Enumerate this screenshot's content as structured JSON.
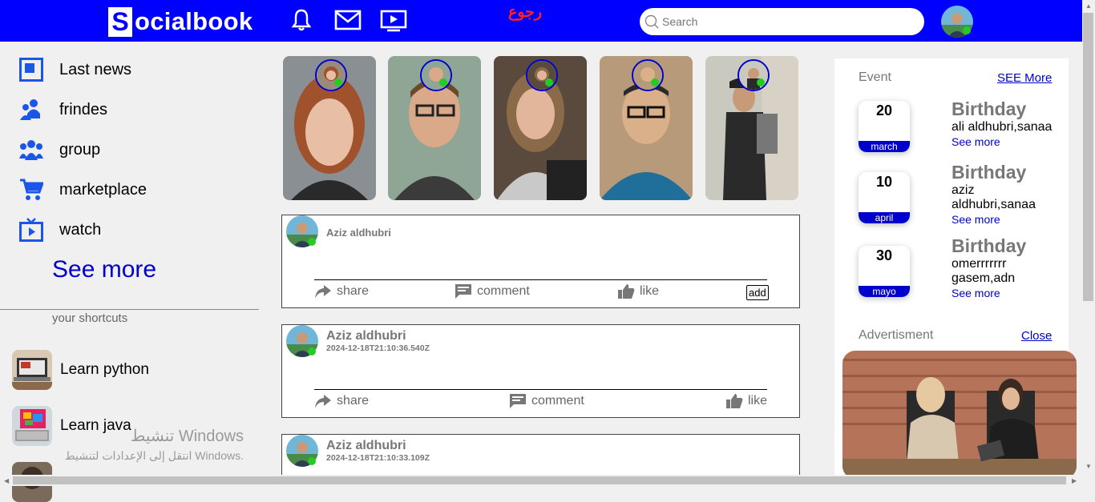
{
  "header": {
    "logo_letter": "S",
    "logo_text": "ocialbook",
    "back_link": "رجوع",
    "search_placeholder": "Search",
    "nav_icons": [
      "bell-icon",
      "mail-icon",
      "video-icon"
    ]
  },
  "sidebar": {
    "items": [
      {
        "label": "Last news",
        "icon": "news-icon"
      },
      {
        "label": "frindes",
        "icon": "friends-icon"
      },
      {
        "label": "group",
        "icon": "group-icon"
      },
      {
        "label": "marketplace",
        "icon": "cart-icon"
      },
      {
        "label": "watch",
        "icon": "tv-icon"
      }
    ],
    "see_more": "See more",
    "shortcuts_title": "your shortcuts",
    "shortcuts": [
      {
        "label": "Learn python"
      },
      {
        "label": "Learn java"
      }
    ]
  },
  "os_watermark": {
    "line1": "تنشيط Windows",
    "line2": "انتقل إلى الإعدادات لتنشيط Windows."
  },
  "stories": [
    {
      "name": "story-1"
    },
    {
      "name": "story-2"
    },
    {
      "name": "story-3"
    },
    {
      "name": "story-4"
    },
    {
      "name": "story-5"
    }
  ],
  "posts": [
    {
      "author": "Aziz aldhubri",
      "date": "",
      "actions": [
        "share",
        "comment",
        "like"
      ],
      "add_label": "add"
    },
    {
      "author": "Aziz aldhubri",
      "date": "2024-12-18T21:10:36.540Z",
      "actions": [
        "share",
        "comment",
        "like"
      ]
    },
    {
      "author": "Aziz aldhubri",
      "date": "2024-12-18T21:10:33.109Z"
    }
  ],
  "events": {
    "title": "Event",
    "see_more": "SEE More",
    "items": [
      {
        "day": "20",
        "month": "march",
        "title": "Birthday",
        "names": "ali aldhubri,sanaa",
        "more": "See more"
      },
      {
        "day": "10",
        "month": "april",
        "title": "Birthday",
        "names": "aziz aldhubri,sanaa",
        "more": "See more"
      },
      {
        "day": "30",
        "month": "mayo",
        "title": "Birthday",
        "names": "omerrrrrrr gasem,adn",
        "more": "See more"
      }
    ]
  },
  "advertisement": {
    "title": "Advertisment",
    "close": "Close"
  },
  "colors": {
    "brand": "#0000ff",
    "link": "#0000cc",
    "online": "#22cc22",
    "back_link": "#ff2020"
  }
}
